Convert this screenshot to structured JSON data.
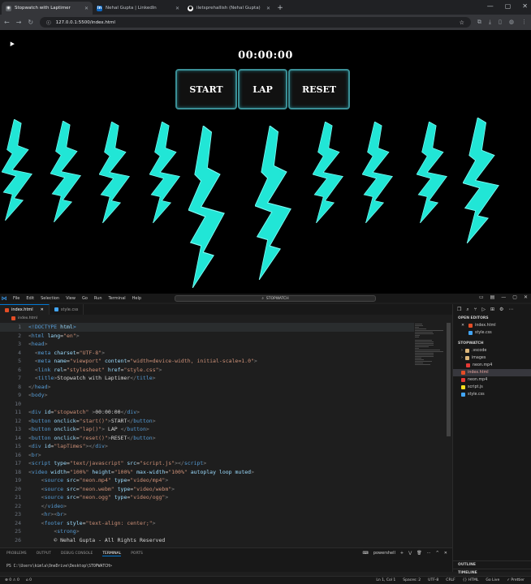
{
  "browser": {
    "tabs": [
      {
        "title": "Stopwatch with Laptimer",
        "icon": "globe-icon",
        "active": true
      },
      {
        "title": "Nehal Gupta | LinkedIn",
        "icon": "linkedin-icon",
        "active": false
      },
      {
        "title": "iletsprehallish (Nehal Gupta)",
        "icon": "github-icon",
        "active": false
      }
    ],
    "new_tab": "+",
    "url": "127.0.0.1:5500/index.html"
  },
  "page": {
    "timer": "00:00:00",
    "buttons": {
      "start": "START",
      "lap": "LAP",
      "reset": "RESET"
    },
    "bolt_color": "#21e6d6"
  },
  "vscode": {
    "menu": [
      "File",
      "Edit",
      "Selection",
      "View",
      "Go",
      "Run",
      "Terminal",
      "Help"
    ],
    "search": "STOPWATCH",
    "tabs": [
      {
        "name": "index.html",
        "color": "#e44d26",
        "active": true
      },
      {
        "name": "style.css",
        "color": "#42a5f5",
        "active": false
      }
    ],
    "breadcrumb": "index.html",
    "lines": [
      {
        "n": "1",
        "html": "<span class='dc'>&lt;!DOCTYPE</span> <span class='at'>html</span><span class='dc'>&gt;</span>"
      },
      {
        "n": "2",
        "html": "<span class='gr'>&lt;</span><span class='tg'>html</span> <span class='at'>lang</span>=<span class='st'>\"en\"</span><span class='gr'>&gt;</span>"
      },
      {
        "n": "3",
        "html": "<span class='gr'>&lt;</span><span class='tg'>head</span><span class='gr'>&gt;</span>"
      },
      {
        "n": "4",
        "html": "  <span class='gr'>&lt;</span><span class='tg'>meta</span> <span class='at'>charset</span>=<span class='st'>\"UTF-8\"</span><span class='gr'>&gt;</span>"
      },
      {
        "n": "5",
        "html": "  <span class='gr'>&lt;</span><span class='tg'>meta</span> <span class='at'>name</span>=<span class='st'>\"viewport\"</span> <span class='at'>content</span>=<span class='st'>\"width=device-width, initial-scale=1.0\"</span><span class='gr'>&gt;</span>"
      },
      {
        "n": "6",
        "html": "  <span class='gr'>&lt;</span><span class='tg'>link</span> <span class='at'>rel</span>=<span class='st'>\"stylesheet\"</span> <span class='at'>href</span>=<span class='st'>\"style.css\"</span><span class='gr'>&gt;</span>"
      },
      {
        "n": "7",
        "html": "  <span class='gr'>&lt;</span><span class='tg'>title</span><span class='gr'>&gt;</span><span class='tx'>Stopwatch with Laptimer</span><span class='gr'>&lt;/</span><span class='tg'>title</span><span class='gr'>&gt;</span>"
      },
      {
        "n": "8",
        "html": "<span class='gr'>&lt;/</span><span class='tg'>head</span><span class='gr'>&gt;</span>"
      },
      {
        "n": "9",
        "html": "<span class='gr'>&lt;</span><span class='tg'>body</span><span class='gr'>&gt;</span>"
      },
      {
        "n": "10",
        "html": ""
      },
      {
        "n": "11",
        "html": "<span class='gr'>&lt;</span><span class='tg'>div</span> <span class='at'>id</span>=<span class='st'>\"stopwatch\"</span> <span class='gr'>&gt;</span><span class='tx'>00:00:00</span><span class='gr'>&lt;/</span><span class='tg'>div</span><span class='gr'>&gt;</span>"
      },
      {
        "n": "12",
        "html": "<span class='gr'>&lt;</span><span class='tg'>button</span> <span class='at'>onclick</span>=<span class='st'>\"start()\"</span><span class='gr'>&gt;</span><span class='tx'>START</span><span class='gr'>&lt;/</span><span class='tg'>button</span><span class='gr'>&gt;</span>"
      },
      {
        "n": "13",
        "html": "<span class='gr'>&lt;</span><span class='tg'>button</span> <span class='at'>onclick</span>=<span class='st'>\"lap()\"</span><span class='gr'>&gt;</span> <span class='tx'>LAP</span> <span class='gr'>&lt;/</span><span class='tg'>button</span><span class='gr'>&gt;</span>"
      },
      {
        "n": "14",
        "html": "<span class='gr'>&lt;</span><span class='tg'>button</span> <span class='at'>onclick</span>=<span class='st'>\"reset()\"</span><span class='gr'>&gt;</span><span class='tx'>RESET</span><span class='gr'>&lt;/</span><span class='tg'>button</span><span class='gr'>&gt;</span>"
      },
      {
        "n": "15",
        "html": "<span class='gr'>&lt;</span><span class='tg'>div</span> <span class='at'>id</span>=<span class='st'>\"lapTimes\"</span><span class='gr'>&gt;&lt;/</span><span class='tg'>div</span><span class='gr'>&gt;</span>"
      },
      {
        "n": "16",
        "html": "<span class='gr'>&lt;</span><span class='tg'>br</span><span class='gr'>&gt;</span>"
      },
      {
        "n": "17",
        "html": "<span class='gr'>&lt;</span><span class='tg'>script</span> <span class='at'>type</span>=<span class='st'>\"text/javascript\"</span> <span class='at'>src</span>=<span class='st'>\"script.js\"</span><span class='gr'>&gt;&lt;/</span><span class='tg'>script</span><span class='gr'>&gt;</span>"
      },
      {
        "n": "18",
        "html": "<span class='gr'>&lt;</span><span class='tg'>video</span> <span class='at'>width</span>=<span class='st'>\"100%\"</span> <span class='at'>height</span>=<span class='st'>\"100%\"</span> <span class='at'>max-width</span>=<span class='st'>\"100%\"</span> <span class='at'>autoplay loop muted</span><span class='gr'>&gt;</span>"
      },
      {
        "n": "19",
        "html": "    <span class='gr'>&lt;</span><span class='tg'>source</span> <span class='at'>src</span>=<span class='st'>\"neon.mp4\"</span> <span class='at'>type</span>=<span class='st'>\"video/mp4\"</span><span class='gr'>&gt;</span>"
      },
      {
        "n": "20",
        "html": "    <span class='gr'>&lt;</span><span class='tg'>source</span> <span class='at'>src</span>=<span class='st'>\"neon.webm\"</span> <span class='at'>type</span>=<span class='st'>\"video/webm\"</span><span class='gr'>&gt;</span>"
      },
      {
        "n": "21",
        "html": "    <span class='gr'>&lt;</span><span class='tg'>source</span> <span class='at'>src</span>=<span class='st'>\"neon.ogg\"</span> <span class='at'>type</span>=<span class='st'>\"video/ogg\"</span><span class='gr'>&gt;</span>"
      },
      {
        "n": "22",
        "html": "    <span class='gr'>&lt;/</span><span class='tg'>video</span><span class='gr'>&gt;</span>"
      },
      {
        "n": "23",
        "html": "    <span class='gr'>&lt;</span><span class='tg'>hr</span><span class='gr'>&gt;&lt;</span><span class='tg'>br</span><span class='gr'>&gt;</span>"
      },
      {
        "n": "24",
        "html": "    <span class='gr'>&lt;</span><span class='tg'>footer</span> <span class='at'>style</span>=<span class='st'>\"text-align: center;\"</span><span class='gr'>&gt;</span>"
      },
      {
        "n": "25",
        "html": "        <span class='gr'>&lt;</span><span class='tg'>strong</span><span class='gr'>&gt;</span>"
      },
      {
        "n": "26",
        "html": "        <span class='tx'>© Nehal Gupta - All Rights Reserved</span>"
      }
    ],
    "explorer": {
      "open_editors": "OPEN EDITORS",
      "open_files": [
        "index.html",
        "style.css"
      ],
      "project": "STOPWATCH",
      "tree": [
        {
          "name": ".vscode",
          "indent": 1,
          "kind": "folder"
        },
        {
          "name": "images",
          "indent": 1,
          "kind": "folder"
        },
        {
          "name": "neon.mp4",
          "indent": 2,
          "kind": "file"
        },
        {
          "name": "index.html",
          "indent": 1,
          "kind": "file"
        },
        {
          "name": "neon.mp4",
          "indent": 1,
          "kind": "file"
        },
        {
          "name": "script.js",
          "indent": 1,
          "kind": "file"
        },
        {
          "name": "style.css",
          "indent": 1,
          "kind": "file"
        }
      ],
      "outline": "OUTLINE",
      "timeline": "TIMELINE"
    },
    "panel": {
      "tabs": [
        "PROBLEMS",
        "OUTPUT",
        "DEBUG CONSOLE",
        "TERMINAL",
        "PORTS"
      ],
      "active": "TERMINAL",
      "shell": "powershell",
      "prompt": "PS C:\\Users\\kimla\\OneDrive\\Desktop\\STOPWATCH>"
    },
    "status": {
      "left": [
        "⊗ 0 ⚠ 0",
        "⌂ 0"
      ],
      "right": [
        "Ln 1, Col 1",
        "Spaces: 2",
        "UTF-8",
        "CRLF",
        "{} HTML",
        "Go Live",
        "✓ Prettier"
      ]
    }
  }
}
